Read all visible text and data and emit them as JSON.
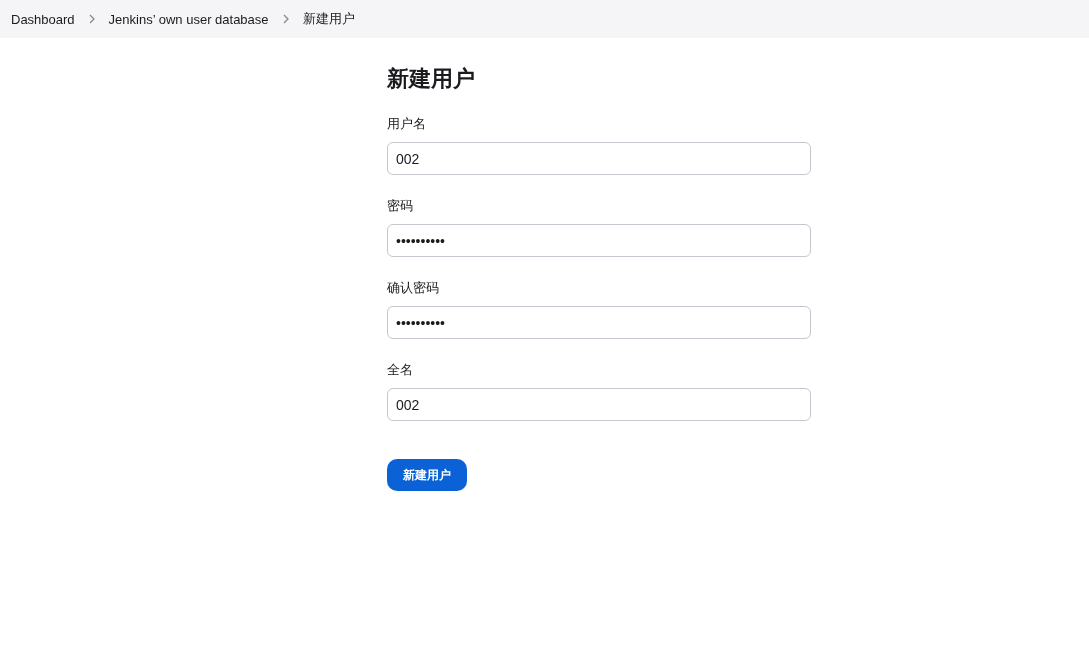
{
  "breadcrumb": [
    {
      "label": "Dashboard"
    },
    {
      "label": "Jenkins’ own user database"
    },
    {
      "label": "新建用户"
    }
  ],
  "form": {
    "title": "新建用户",
    "fields": [
      {
        "label": "用户名",
        "value": "002"
      },
      {
        "label": "密码",
        "value": "••••••••••"
      },
      {
        "label": "确认密码",
        "value": "••••••••••"
      },
      {
        "label": "全名",
        "value": "002"
      }
    ],
    "submit": "新建用户"
  }
}
